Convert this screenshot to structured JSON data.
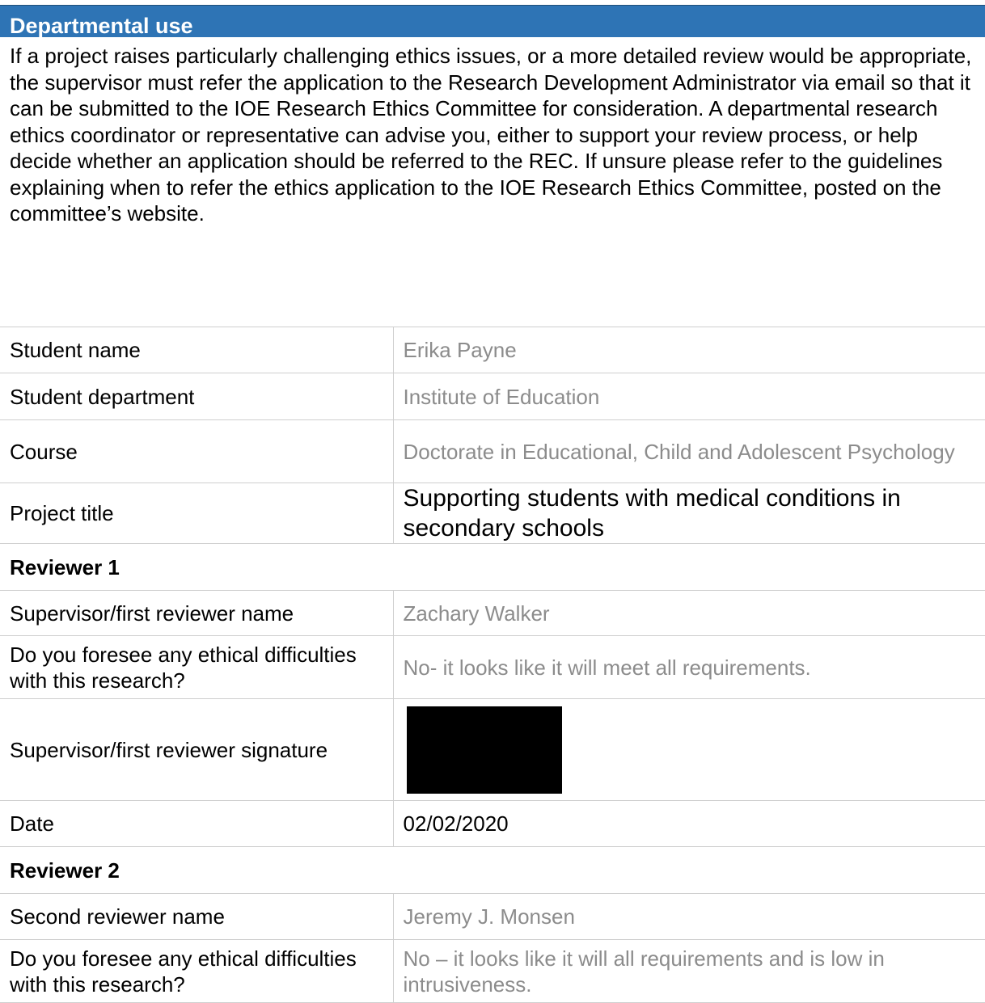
{
  "header": {
    "title": "Departmental use"
  },
  "intro": {
    "text": "If a project raises particularly challenging ethics issues, or a more detailed review would be appropriate, the supervisor must refer the application to the Research Development Administrator via email so that it can be submitted to the IOE Research Ethics Committee for consideration. A departmental research ethics coordinator or representative can advise you, either to support your review process, or help decide whether an application should be referred to the REC. If unsure please refer to the guidelines explaining when to refer the ethics application to the IOE Research Ethics Committee, posted on the committee’s website."
  },
  "fields": {
    "student_name": {
      "label": "Student name",
      "value": "Erika Payne"
    },
    "student_department": {
      "label": "Student department",
      "value": "Institute of Education"
    },
    "course": {
      "label": "Course",
      "value": "Doctorate in Educational, Child and Adolescent Psychology"
    },
    "project_title": {
      "label": "Project title",
      "value": "Supporting students with medical conditions in secondary schools"
    }
  },
  "reviewer1": {
    "heading": "Reviewer 1",
    "name_label": "Supervisor/first reviewer name",
    "name_value": "Zachary Walker",
    "difficulties_label": "Do you foresee any ethical difficulties with this research?",
    "difficulties_value": "No- it looks like it will meet all requirements.",
    "signature_label": "Supervisor/first reviewer signature",
    "date_label": "Date",
    "date_value": "02/02/2020"
  },
  "reviewer2": {
    "heading": "Reviewer 2",
    "name_label": "Second reviewer name",
    "name_value": "Jeremy J. Monsen",
    "difficulties_label": "Do you foresee any ethical difficulties with this research?",
    "difficulties_value": "No – it looks like it will all requirements and is low in intrusiveness."
  }
}
